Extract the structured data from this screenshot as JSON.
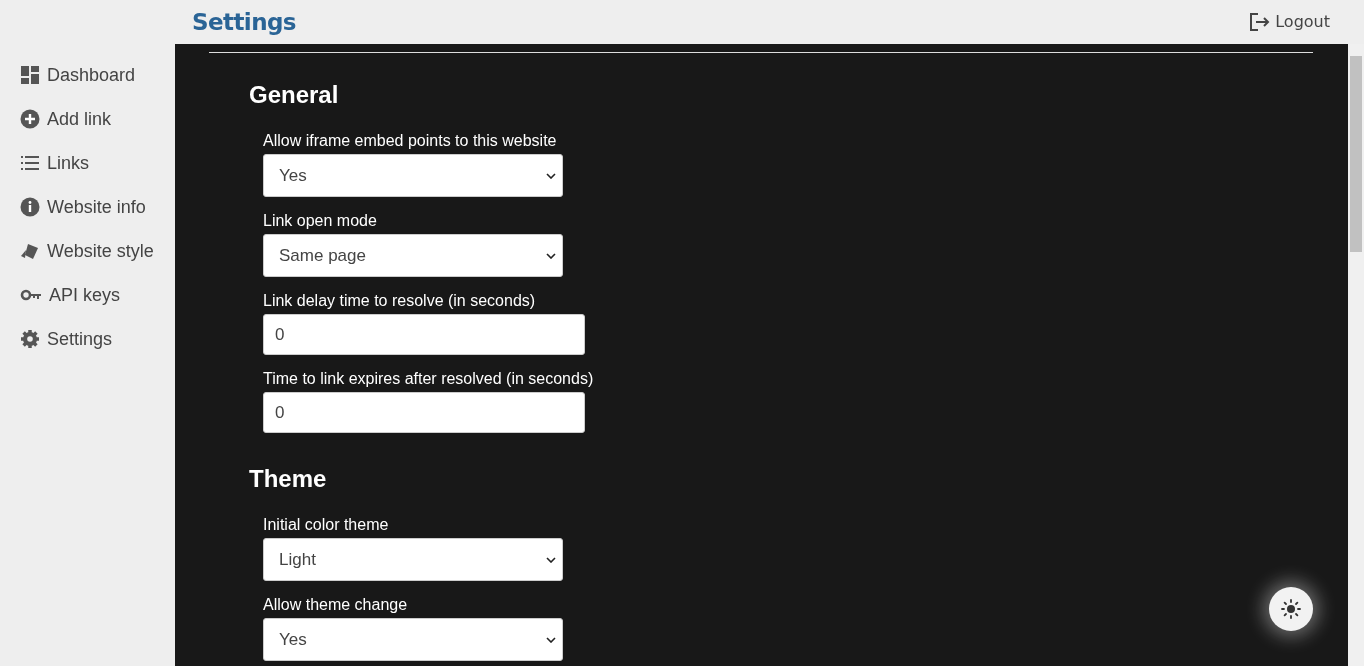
{
  "header": {
    "title": "Settings",
    "logout": "Logout"
  },
  "sidebar": {
    "items": [
      {
        "label": "Dashboard"
      },
      {
        "label": "Add link"
      },
      {
        "label": "Links"
      },
      {
        "label": "Website info"
      },
      {
        "label": "Website style"
      },
      {
        "label": "API keys"
      },
      {
        "label": "Settings"
      }
    ]
  },
  "sections": [
    {
      "title": "General",
      "fields": [
        {
          "kind": "select",
          "label": "Allow iframe embed points to this website",
          "value": "Yes"
        },
        {
          "kind": "select",
          "label": "Link open mode",
          "value": "Same page"
        },
        {
          "kind": "input",
          "label": "Link delay time to resolve (in seconds)",
          "value": "0"
        },
        {
          "kind": "input",
          "label": "Time to link expires after resolved (in seconds)",
          "value": "0"
        }
      ]
    },
    {
      "title": "Theme",
      "fields": [
        {
          "kind": "select",
          "label": "Initial color theme",
          "value": "Light"
        },
        {
          "kind": "select",
          "label": "Allow theme change",
          "value": "Yes"
        }
      ]
    }
  ]
}
